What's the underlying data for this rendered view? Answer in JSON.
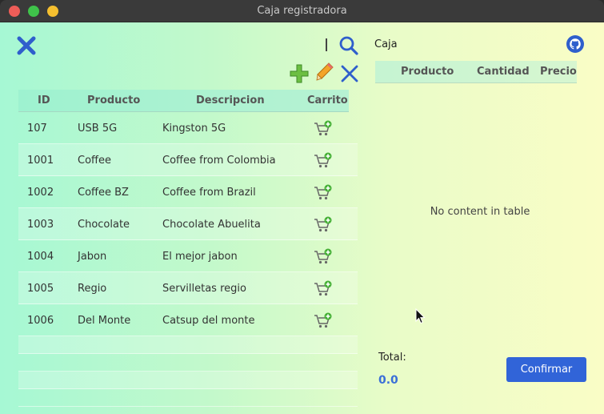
{
  "window": {
    "title": "Caja registradora"
  },
  "toolbar": {
    "icons": [
      "close-icon",
      "search-icon",
      "add-icon",
      "edit-icon",
      "delete-icon"
    ]
  },
  "products_table": {
    "headers": [
      "ID",
      "Producto",
      "Descripcion",
      "Carrito"
    ],
    "rows": [
      [
        "107",
        "USB 5G",
        "Kingston 5G"
      ],
      [
        "1001",
        "Coffee",
        "Coffee from Colombia"
      ],
      [
        "1002",
        "Coffee BZ",
        "Coffee from Brazil"
      ],
      [
        "1003",
        "Chocolate",
        "Chocolate Abuelita"
      ],
      [
        "1004",
        "Jabon",
        "El mejor jabon"
      ],
      [
        "1005",
        "Regio",
        "Servilletas regio"
      ],
      [
        "1006",
        "Del Monte",
        "Catsup del monte"
      ]
    ]
  },
  "caja": {
    "label": "Caja",
    "headers": [
      "Producto",
      "Cantidad",
      "Precio"
    ],
    "empty_text": "No content in table"
  },
  "footer": {
    "total_label": "Total:",
    "total_value": "0.0",
    "confirm_label": "Confirmar"
  },
  "colors": {
    "accent": "#3164d8",
    "close_icon": "#2f5fcc",
    "add_icon": "#5cab3c",
    "total_value": "#3a6fd8"
  }
}
